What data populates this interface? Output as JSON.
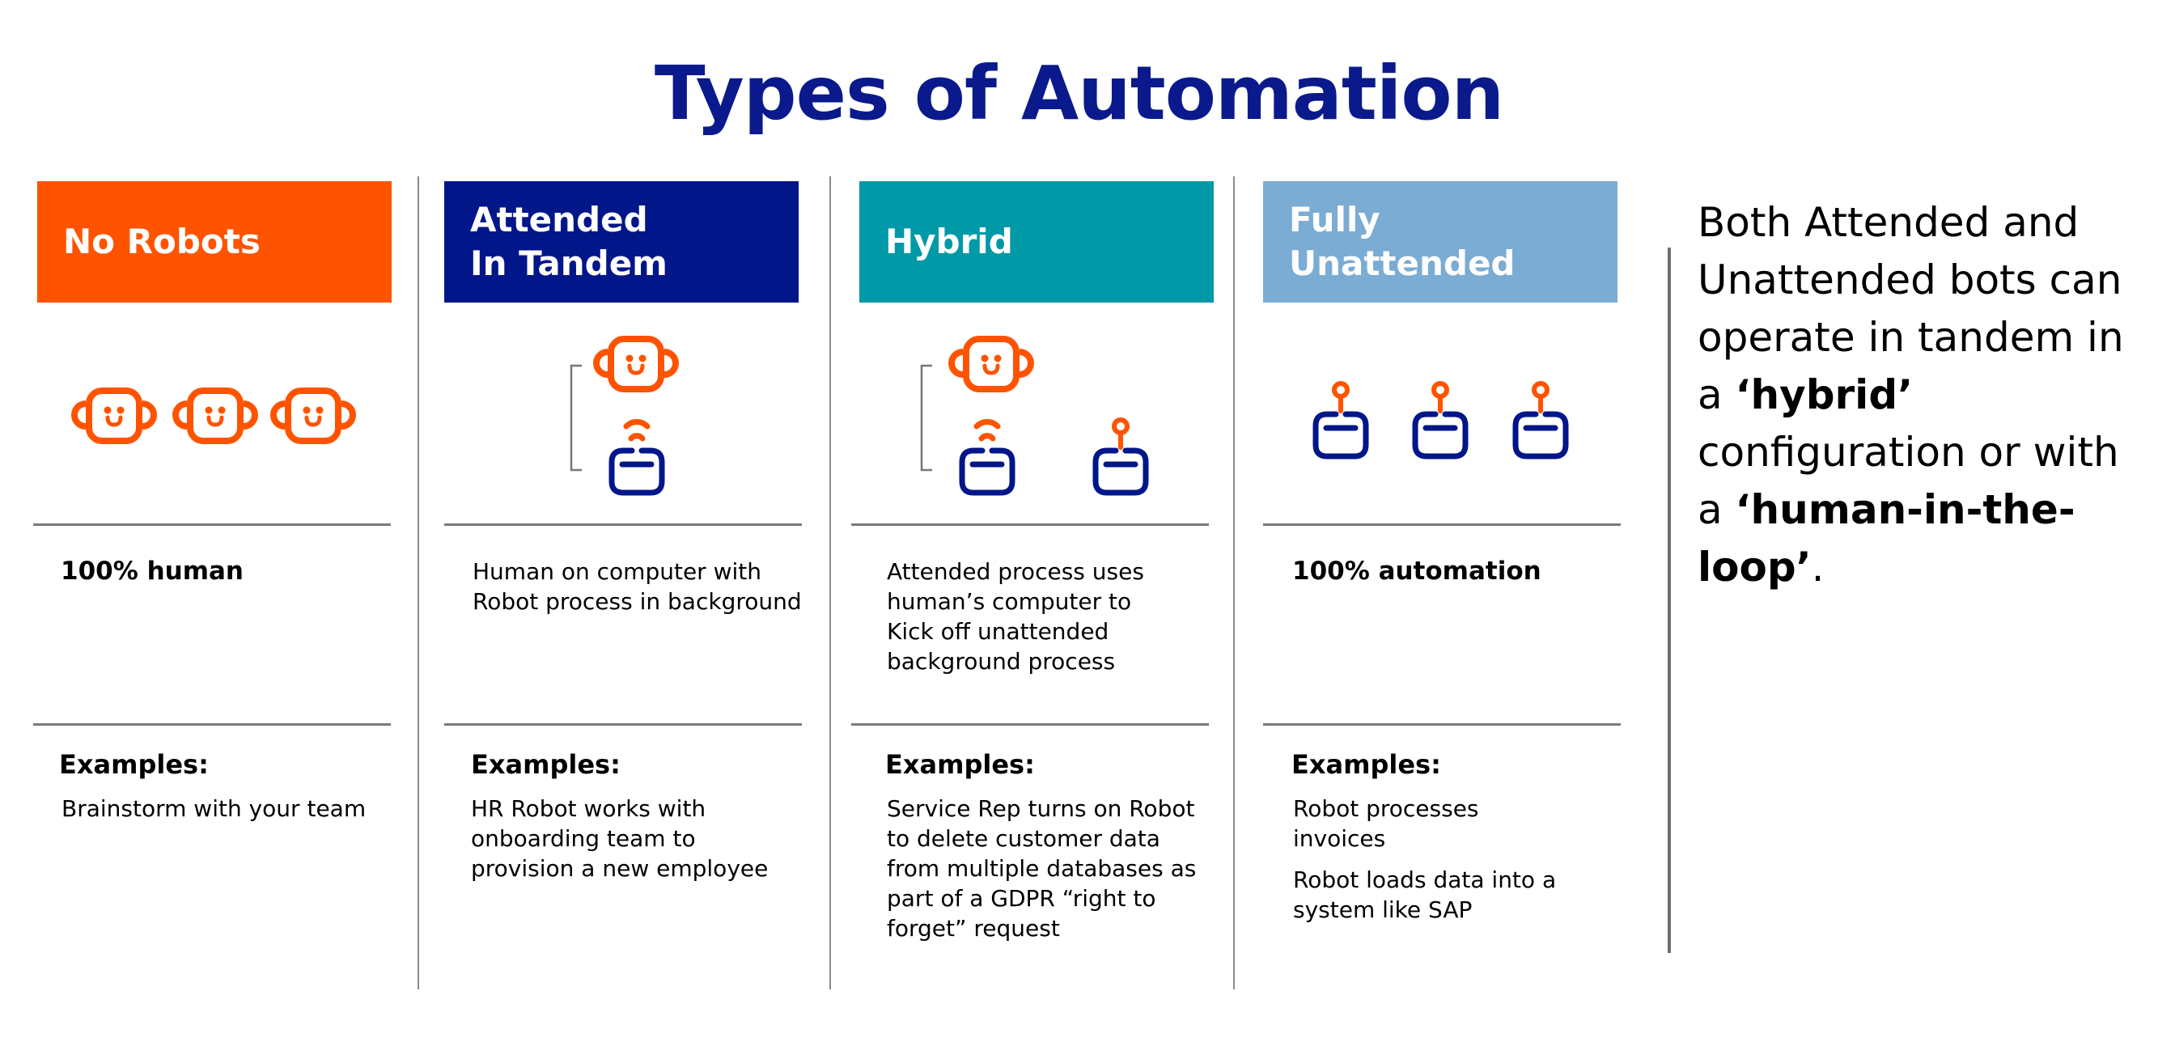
{
  "title": "Types of Automation",
  "colors": {
    "title": "#0a1a8c",
    "orange": "#ff5300",
    "navy": "#001689",
    "teal": "#0099a8",
    "light_blue": "#7bacd3",
    "divider": "#8a8a8a"
  },
  "columns": [
    {
      "header": [
        "No Robots"
      ],
      "header_color": "#ff5300",
      "icon": "three-human-robot-faces",
      "description": [
        "100% human"
      ],
      "description_bold": true,
      "examples_label": "Examples:",
      "examples": [
        [
          "Brainstorm with your team"
        ]
      ]
    },
    {
      "header": [
        "Attended",
        "In Tandem"
      ],
      "header_color": "#001689",
      "icon": "human-face-with-wifi-bot",
      "description": [
        "Human on computer with",
        "Robot process in background"
      ],
      "description_bold": false,
      "examples_label": "Examples:",
      "examples": [
        [
          "HR Robot works with",
          "onboarding team to",
          "provision a new employee"
        ]
      ]
    },
    {
      "header": [
        "Hybrid"
      ],
      "header_color": "#0099a8",
      "icon": "human-face-with-wifi-bot-and-antenna-bot",
      "description": [
        "Attended process uses",
        "human’s computer to",
        "Kick off unattended",
        "background process"
      ],
      "description_bold": false,
      "examples_label": "Examples:",
      "examples": [
        [
          "Service Rep turns on Robot",
          "to delete customer data",
          "from multiple databases as",
          "part of a GDPR “right to",
          "forget” request"
        ]
      ]
    },
    {
      "header": [
        "Fully",
        "Unattended"
      ],
      "header_color": "#7bacd3",
      "icon": "three-antenna-bots",
      "description": [
        "100% automation"
      ],
      "description_bold": true,
      "examples_label": "Examples:",
      "examples": [
        [
          "Robot processes",
          "invoices"
        ],
        [
          "Robot loads data into a",
          "system like SAP"
        ]
      ]
    }
  ],
  "side_note": {
    "lines": [
      {
        "plain": "Both Attended and",
        "bold": ""
      },
      {
        "plain": "Unattended bots can",
        "bold": ""
      },
      {
        "plain": "operate in tandem in",
        "bold": ""
      },
      {
        "plain": "a ",
        "bold": "‘hybrid’"
      },
      {
        "plain": "configuration or with",
        "bold": ""
      },
      {
        "plain": "a ",
        "bold": "‘human-in-the-"
      },
      {
        "plain": "",
        "bold": "loop’",
        "tail": "."
      }
    ]
  }
}
